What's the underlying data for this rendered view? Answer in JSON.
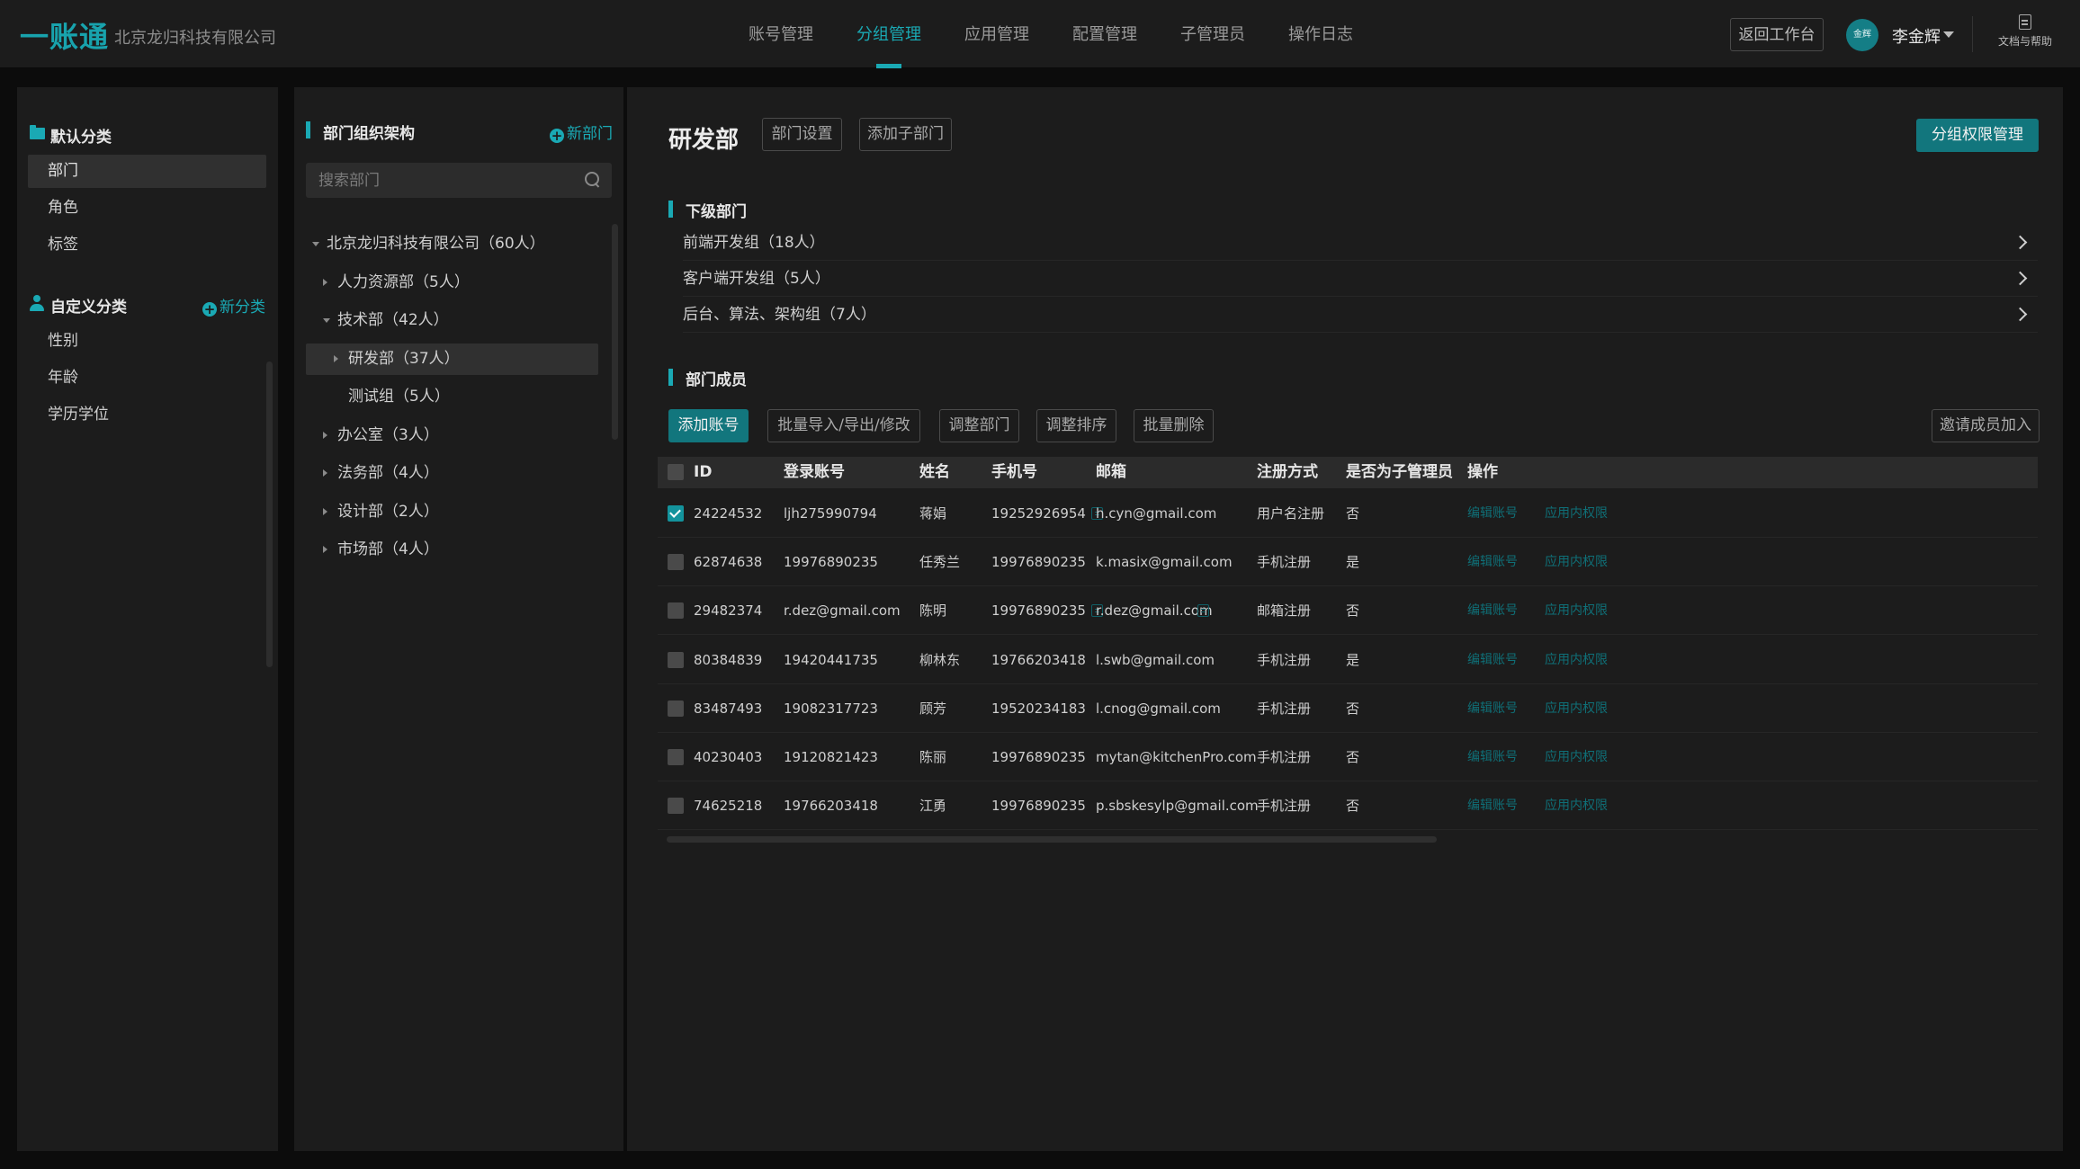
{
  "app": {
    "logo": "一账通",
    "company": "北京龙归科技有限公司",
    "nav": [
      {
        "label": "账号管理",
        "active": false
      },
      {
        "label": "分组管理",
        "active": true
      },
      {
        "label": "应用管理",
        "active": false
      },
      {
        "label": "配置管理",
        "active": false
      },
      {
        "label": "子管理员",
        "active": false
      },
      {
        "label": "操作日志",
        "active": false
      }
    ],
    "return_label": "返回工作台",
    "avatar_text": "金辉",
    "username": "李金辉",
    "help_label": "文档与帮助",
    "accent_color": "#1aa9b4"
  },
  "sidebar": {
    "default_section": {
      "label": "默认分类",
      "icon": "folder-icon",
      "items": [
        {
          "label": "部门",
          "active": true
        },
        {
          "label": "角色",
          "active": false
        },
        {
          "label": "标签",
          "active": false
        }
      ]
    },
    "custom_section": {
      "label": "自定义分类",
      "icon": "person-icon",
      "add_label": "新分类",
      "items": [
        {
          "label": "性别"
        },
        {
          "label": "年龄"
        },
        {
          "label": "学历学位"
        }
      ]
    }
  },
  "tree": {
    "title": "部门组织架构",
    "add_label": "新部门",
    "search_placeholder": "搜索部门",
    "nodes": [
      {
        "label": "北京龙归科技有限公司（60人）",
        "depth": 0,
        "expanded": true,
        "selected": false
      },
      {
        "label": "人力资源部（5人）",
        "depth": 1,
        "expanded": false,
        "selected": false
      },
      {
        "label": "技术部（42人）",
        "depth": 1,
        "expanded": true,
        "selected": false
      },
      {
        "label": "研发部（37人）",
        "depth": 2,
        "expanded": false,
        "selected": true
      },
      {
        "label": "测试组（5人）",
        "depth": 2,
        "expanded": false,
        "selected": false,
        "leaf": true
      },
      {
        "label": "办公室（3人）",
        "depth": 1,
        "expanded": false,
        "selected": false
      },
      {
        "label": "法务部（4人）",
        "depth": 1,
        "expanded": false,
        "selected": false
      },
      {
        "label": "设计部（2人）",
        "depth": 1,
        "expanded": false,
        "selected": false
      },
      {
        "label": "市场部（4人）",
        "depth": 1,
        "expanded": false,
        "selected": false
      }
    ]
  },
  "main": {
    "title": "研发部",
    "settings_label": "部门设置",
    "add_child_label": "添加子部门",
    "perm_label": "分组权限管理",
    "sub_section_label": "下级部门",
    "sub_depts": [
      "前端开发组（18人）",
      "客户端开发组（5人）",
      "后台、算法、架构组（7人）"
    ],
    "members_section_label": "部门成员",
    "actions": {
      "add_account": "添加账号",
      "bulk_import": "批量导入/导出/修改",
      "adjust_dept": "调整部门",
      "adjust_order": "调整排序",
      "bulk_delete": "批量删除",
      "invite": "邀请成员加入"
    },
    "columns": [
      "ID",
      "登录账号",
      "姓名",
      "手机号",
      "邮箱",
      "注册方式",
      "是否为子管理员",
      "操作"
    ],
    "row_actions": {
      "edit": "编辑账号",
      "perm": "应用内权限"
    },
    "rows": [
      {
        "id": "24224532",
        "login": "ljh275990794",
        "name": "蒋娟",
        "phone": "19252926954",
        "phone_icon": true,
        "email": "h.cyn@gmail.com",
        "email_icon": false,
        "reg": "用户名注册",
        "is_admin": "否",
        "checked": true
      },
      {
        "id": "62874638",
        "login": "19976890235",
        "name": "任秀兰",
        "phone": "19976890235",
        "phone_icon": false,
        "email": "k.masix@gmail.com",
        "email_icon": false,
        "reg": "手机注册",
        "is_admin": "是",
        "checked": false
      },
      {
        "id": "29482374",
        "login": "r.dez@gmail.com",
        "name": "陈明",
        "phone": "19976890235",
        "phone_icon": true,
        "email": "r.dez@gmail.com",
        "email_icon": true,
        "reg": "邮箱注册",
        "is_admin": "否",
        "checked": false
      },
      {
        "id": "80384839",
        "login": "19420441735",
        "name": "柳林东",
        "phone": "19766203418",
        "phone_icon": false,
        "email": "l.swb@gmail.com",
        "email_icon": false,
        "reg": "手机注册",
        "is_admin": "是",
        "checked": false
      },
      {
        "id": "83487493",
        "login": "19082317723",
        "name": "顾芳",
        "phone": "19520234183",
        "phone_icon": false,
        "email": "l.cnog@gmail.com",
        "email_icon": false,
        "reg": "手机注册",
        "is_admin": "否",
        "checked": false
      },
      {
        "id": "40230403",
        "login": "19120821423",
        "name": "陈丽",
        "phone": "19976890235",
        "phone_icon": false,
        "email": "mytan@kitchenPro.com",
        "email_icon": false,
        "reg": "手机注册",
        "is_admin": "否",
        "checked": false
      },
      {
        "id": "74625218",
        "login": "19766203418",
        "name": "江勇",
        "phone": "19976890235",
        "phone_icon": false,
        "email": "p.sbskesylp@gmail.com",
        "email_icon": false,
        "reg": "手机注册",
        "is_admin": "否",
        "checked": false
      }
    ]
  }
}
